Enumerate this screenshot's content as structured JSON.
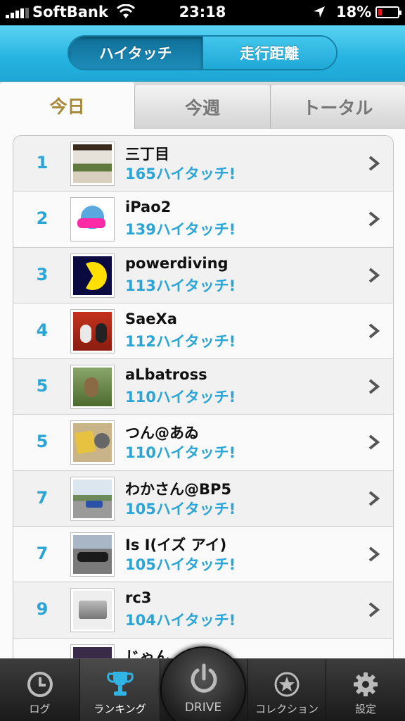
{
  "status_bar": {
    "carrier": "SoftBank",
    "time": "23:18",
    "battery_percent": "18%",
    "battery_level": 0.18,
    "icons": [
      "signal-icon",
      "wifi-icon",
      "location-arrow-icon",
      "battery-icon"
    ]
  },
  "header": {
    "segments": [
      {
        "label": "ハイタッチ",
        "active": true
      },
      {
        "label": "走行距離",
        "active": false
      }
    ]
  },
  "tabs": [
    {
      "label": "今日",
      "active": true
    },
    {
      "label": "今週",
      "active": false
    },
    {
      "label": "トータル",
      "active": false
    }
  ],
  "ranking": [
    {
      "rank": "1",
      "name": "三丁目",
      "count": "165ハイタッチ!"
    },
    {
      "rank": "2",
      "name": "iPao2",
      "count": "139ハイタッチ!"
    },
    {
      "rank": "3",
      "name": "powerdiving",
      "count": "113ハイタッチ!"
    },
    {
      "rank": "4",
      "name": "SaeXa",
      "count": "112ハイタッチ!"
    },
    {
      "rank": "5",
      "name": "aLbatross",
      "count": "110ハイタッチ!"
    },
    {
      "rank": "5",
      "name": "つん@あゐ",
      "count": "110ハイタッチ!"
    },
    {
      "rank": "7",
      "name": "わかさん@BP5",
      "count": "105ハイタッチ!"
    },
    {
      "rank": "7",
      "name": "Is I(イズ アイ)",
      "count": "105ハイタッチ!"
    },
    {
      "rank": "9",
      "name": "rc3",
      "count": "104ハイタッチ!"
    },
    {
      "rank": "",
      "name": "じゃん",
      "count": ""
    }
  ],
  "tabbar": {
    "items": [
      {
        "label": "ログ",
        "icon": "clock-icon"
      },
      {
        "label": "ランキング",
        "icon": "trophy-icon",
        "active": true
      },
      {
        "label": "DRIVE",
        "icon": "power-icon"
      },
      {
        "label": "コレクション",
        "icon": "star-badge-icon"
      },
      {
        "label": "設定",
        "icon": "gear-icon"
      }
    ]
  },
  "colors": {
    "header_blue": "#25b3e0",
    "accent_blue": "#2ba5d6",
    "active_tab_text": "#a6893a"
  }
}
